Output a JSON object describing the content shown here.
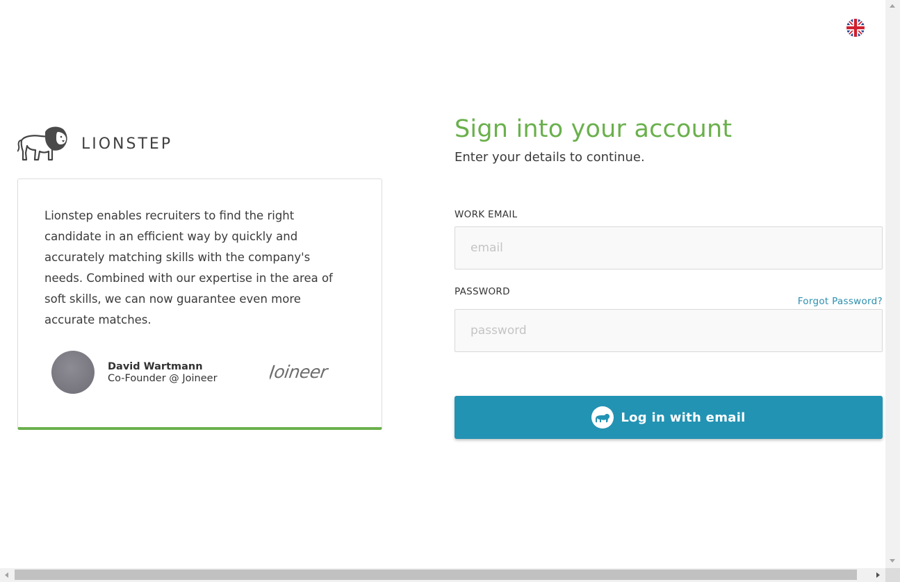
{
  "language": {
    "icon": "uk-flag-icon"
  },
  "brand": {
    "name": "LIONSTEP",
    "logo_icon": "lion-logo-icon"
  },
  "testimonial": {
    "quote": "Lionstep enables recruiters to find the right candidate in an efficient way by quickly and accurately matching skills with the company's needs. Combined with our expertise in the area of soft skills, we can now guarantee even more accurate matches.",
    "person_name": "David Wartmann",
    "person_role": "Co-Founder @ Joineer",
    "company_logo_text": "Joineer",
    "accent_color": "#6ab04c"
  },
  "login": {
    "title": "Sign into your account",
    "subtitle": "Enter your details to continue.",
    "email_label": "WORK EMAIL",
    "email_placeholder": "email",
    "email_value": "",
    "password_label": "PASSWORD",
    "password_placeholder": "password",
    "password_value": "",
    "forgot_label": "Forgot Password?",
    "submit_label": "Log in with email",
    "submit_icon": "lion-icon",
    "button_color": "#2393b3",
    "title_color": "#6ab04c"
  }
}
